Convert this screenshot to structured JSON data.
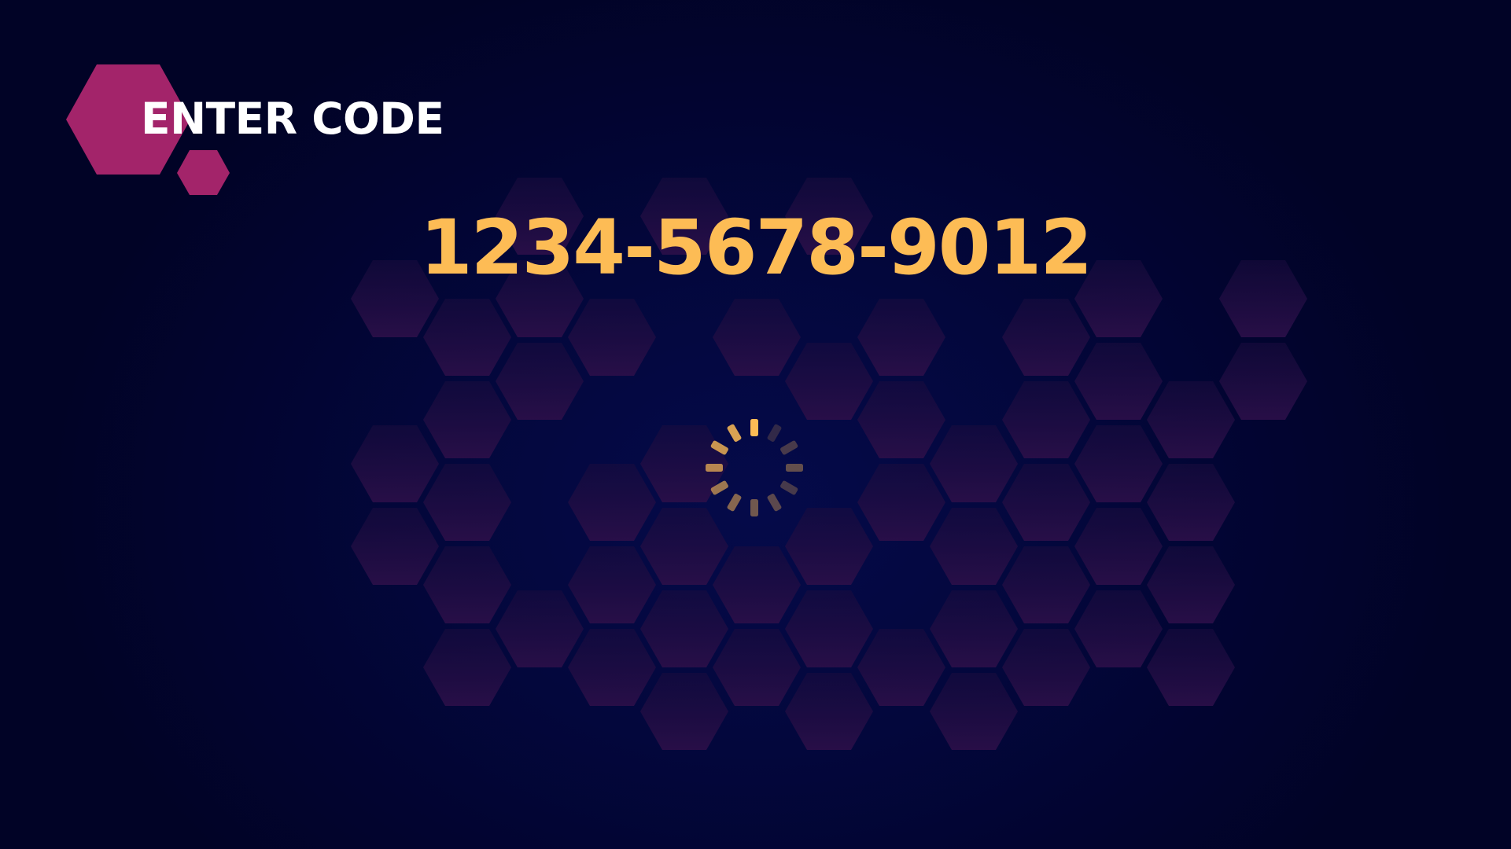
{
  "screen": {
    "title": "ENTER CODE",
    "code": "1234-5678-9012"
  },
  "icons": {
    "title_badge": "hexagon-badge-icon",
    "spinner": "loading-spinner-icon"
  },
  "colors": {
    "background": "#02042a",
    "badge": "#a3246a",
    "code": "#fdbc55",
    "title": "#ffffff",
    "hex_tiles": "#241045"
  }
}
